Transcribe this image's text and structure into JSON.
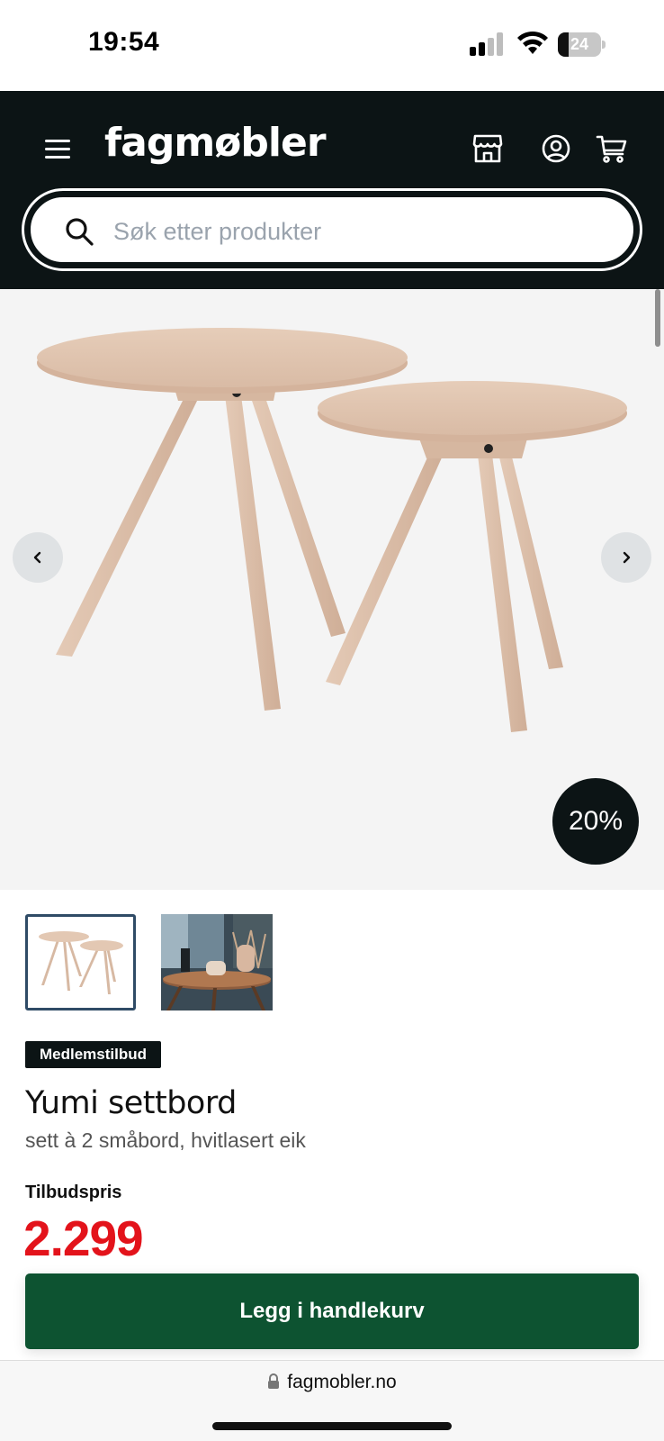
{
  "status_bar": {
    "time": "19:54",
    "battery_level": "24",
    "battery_fraction": 0.24,
    "icons": [
      "cellular-signal-icon",
      "wifi-icon",
      "battery-icon"
    ]
  },
  "header": {
    "logo": "fagmøbler",
    "icons": [
      "menu-icon",
      "store-icon",
      "user-icon",
      "cart-icon"
    ],
    "background_color": "#0c1415"
  },
  "search": {
    "placeholder": "Søk etter produkter",
    "value": ""
  },
  "gallery": {
    "discount_badge": "20%",
    "prev_icon": "chevron-left-icon",
    "next_icon": "chevron-right-icon",
    "thumbnail_count": 2
  },
  "product": {
    "badge": "Medlemstilbud",
    "title": "Yumi settbord",
    "subtitle": "sett à 2 småbord, hvitlasert eik",
    "price_label": "Tilbudspris",
    "price": "2.299",
    "price_color": "#e3131b"
  },
  "cta": {
    "label": "Legg i handlekurv",
    "color": "#0d5331"
  },
  "browser": {
    "url": "fagmobler.no"
  }
}
